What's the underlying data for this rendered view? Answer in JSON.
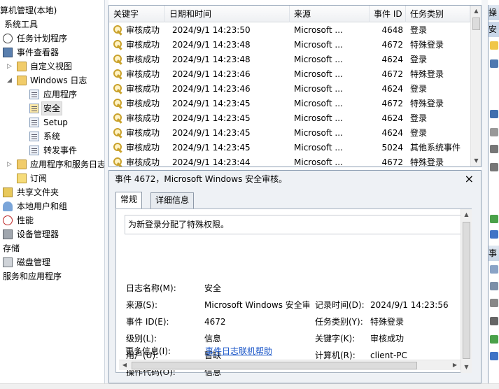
{
  "tree": {
    "items": [
      {
        "label": "算机管理(本地)",
        "icon": "computer-mgmt-icon"
      },
      {
        "label": "系统工具",
        "icon": ""
      },
      {
        "label": "任务计划程序",
        "icon": "clock-icon"
      },
      {
        "label": "事件查看器",
        "icon": "event-viewer-icon"
      },
      {
        "label": "自定义视图",
        "icon": "folder-icon"
      },
      {
        "label": "Windows 日志",
        "icon": "folder-icon"
      },
      {
        "label": "应用程序",
        "icon": "log-icon"
      },
      {
        "label": "安全",
        "icon": "log-icon"
      },
      {
        "label": "Setup",
        "icon": "log-icon"
      },
      {
        "label": "系统",
        "icon": "log-icon"
      },
      {
        "label": "转发事件",
        "icon": "log-icon"
      },
      {
        "label": "应用程序和服务日志",
        "icon": "folder-icon"
      },
      {
        "label": "订阅",
        "icon": "subscription-icon"
      },
      {
        "label": "共享文件夹",
        "icon": "shared-folder-icon"
      },
      {
        "label": "本地用户和组",
        "icon": "users-icon"
      },
      {
        "label": "性能",
        "icon": "performance-icon"
      },
      {
        "label": "设备管理器",
        "icon": "device-manager-icon"
      },
      {
        "label": "存储",
        "icon": ""
      },
      {
        "label": "磁盘管理",
        "icon": "disk-icon"
      },
      {
        "label": "服务和应用程序",
        "icon": ""
      }
    ]
  },
  "events": {
    "columns": [
      "关键字",
      "日期和时间",
      "来源",
      "事件 ID",
      "任务类别"
    ],
    "rows": [
      {
        "keyword": "审核成功",
        "datetime": "2024/9/1 14:23:50",
        "source": "Microsoft ...",
        "id": "4648",
        "category": "登录"
      },
      {
        "keyword": "审核成功",
        "datetime": "2024/9/1 14:23:48",
        "source": "Microsoft ...",
        "id": "4672",
        "category": "特殊登录"
      },
      {
        "keyword": "审核成功",
        "datetime": "2024/9/1 14:23:48",
        "source": "Microsoft ...",
        "id": "4624",
        "category": "登录"
      },
      {
        "keyword": "审核成功",
        "datetime": "2024/9/1 14:23:46",
        "source": "Microsoft ...",
        "id": "4672",
        "category": "特殊登录"
      },
      {
        "keyword": "审核成功",
        "datetime": "2024/9/1 14:23:46",
        "source": "Microsoft ...",
        "id": "4624",
        "category": "登录"
      },
      {
        "keyword": "审核成功",
        "datetime": "2024/9/1 14:23:45",
        "source": "Microsoft ...",
        "id": "4672",
        "category": "特殊登录"
      },
      {
        "keyword": "审核成功",
        "datetime": "2024/9/1 14:23:45",
        "source": "Microsoft ...",
        "id": "4624",
        "category": "登录"
      },
      {
        "keyword": "审核成功",
        "datetime": "2024/9/1 14:23:45",
        "source": "Microsoft ...",
        "id": "4624",
        "category": "登录"
      },
      {
        "keyword": "审核成功",
        "datetime": "2024/9/1 14:23:45",
        "source": "Microsoft ...",
        "id": "5024",
        "category": "其他系统事件"
      },
      {
        "keyword": "审核成功",
        "datetime": "2024/9/1 14:23:44",
        "source": "Microsoft ...",
        "id": "4672",
        "category": "特殊登录"
      }
    ]
  },
  "detail": {
    "title": "事件 4672，Microsoft Windows 安全审核。",
    "close_label": "×",
    "tabs": [
      "常规",
      "详细信息"
    ],
    "description": "为新登录分配了特殊权限。",
    "fields": {
      "log_name_label": "日志名称(M):",
      "log_name": "安全",
      "source_label": "来源(S):",
      "source": "Microsoft Windows 安全审",
      "logged_label": "记录时间(D):",
      "logged": "2024/9/1 14:23:56",
      "event_id_label": "事件 ID(E):",
      "event_id": "4672",
      "task_label": "任务类别(Y):",
      "task": "特殊登录",
      "level_label": "级别(L):",
      "level": "信息",
      "keywords_label": "关键字(K):",
      "keywords": "审核成功",
      "user_label": "用户(U):",
      "user": "暂缺",
      "computer_label": "计算机(R):",
      "computer": "client-PC",
      "opcode_label": "操作代码(O):",
      "opcode": "信息",
      "more_info_label": "更多信息(I):",
      "more_info_link": "事件日志联机帮助"
    }
  },
  "actions": {
    "header_top": "操",
    "section1_label": "安",
    "section2_label": "事"
  }
}
